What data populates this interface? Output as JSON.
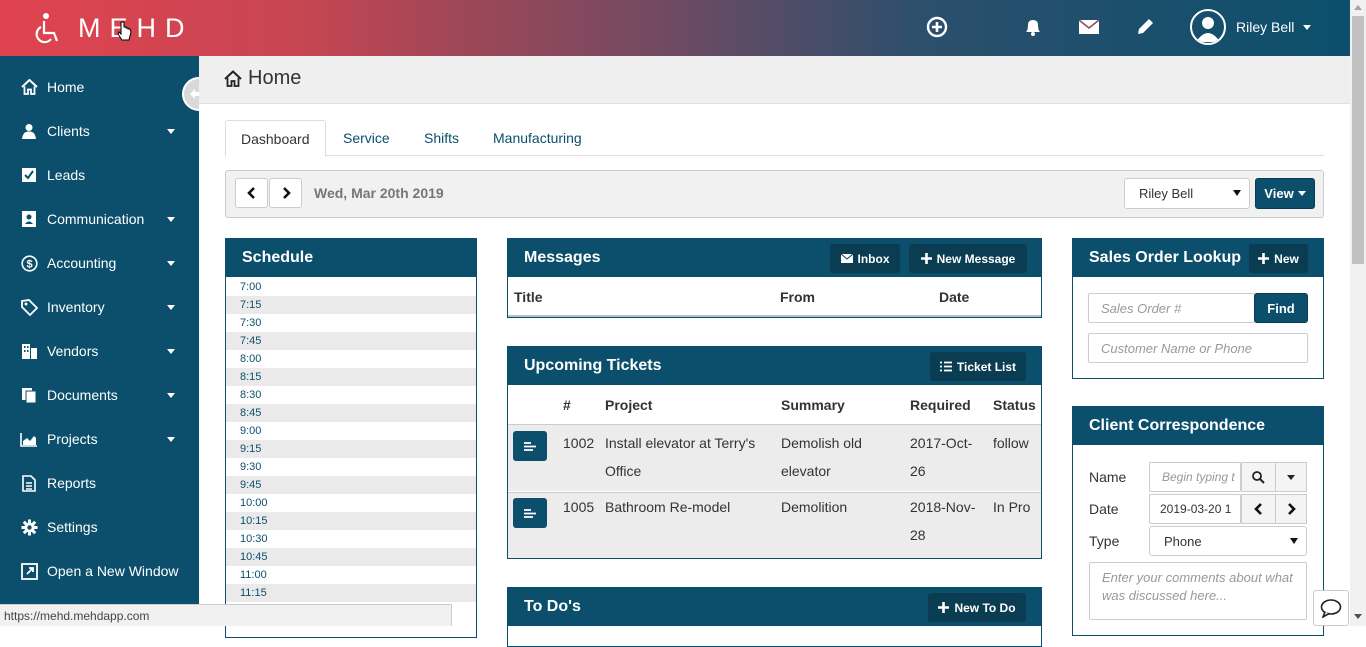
{
  "app": {
    "logo_text": "MEHD",
    "colors": {
      "primary": "#0b4f6c",
      "brand_red": "#e0434f",
      "header_bg": "#efefef"
    },
    "topbar_icons": [
      "plus-circle-icon",
      "bell-icon",
      "envelope-icon",
      "pencil-icon"
    ],
    "user": {
      "name": "Riley Bell",
      "avatar_icon": "user-circle-icon"
    }
  },
  "sidebar": {
    "items": [
      {
        "label": "Home",
        "icon": "home-icon",
        "has_caret": false
      },
      {
        "label": "Clients",
        "icon": "user-icon",
        "has_caret": true
      },
      {
        "label": "Leads",
        "icon": "check-square-icon",
        "has_caret": false
      },
      {
        "label": "Communication",
        "icon": "contact-card-icon",
        "has_caret": true
      },
      {
        "label": "Accounting",
        "icon": "dollar-circle-icon",
        "has_caret": true
      },
      {
        "label": "Inventory",
        "icon": "tag-icon",
        "has_caret": true
      },
      {
        "label": "Vendors",
        "icon": "building-icon",
        "has_caret": true
      },
      {
        "label": "Documents",
        "icon": "files-icon",
        "has_caret": true
      },
      {
        "label": "Projects",
        "icon": "area-chart-icon",
        "has_caret": true
      },
      {
        "label": "Reports",
        "icon": "report-icon",
        "has_caret": false
      },
      {
        "label": "Settings",
        "icon": "gear-icon",
        "has_caret": false
      },
      {
        "label": "Open a New Window",
        "icon": "external-window-icon",
        "has_caret": false
      }
    ]
  },
  "page": {
    "title": "Home",
    "tabs": [
      {
        "label": "Dashboard",
        "active": true
      },
      {
        "label": "Service",
        "active": false
      },
      {
        "label": "Shifts",
        "active": false
      },
      {
        "label": "Manufacturing",
        "active": false
      }
    ],
    "datebar": {
      "date": "Wed, Mar 20th 2019",
      "user_select": "Riley Bell",
      "view_label": "View"
    }
  },
  "schedule": {
    "title": "Schedule",
    "times": [
      "7:00",
      "7:15",
      "7:30",
      "7:45",
      "8:00",
      "8:15",
      "8:30",
      "8:45",
      "9:00",
      "9:15",
      "9:30",
      "9:45",
      "10:00",
      "10:15",
      "10:30",
      "10:45",
      "11:00",
      "11:15"
    ]
  },
  "messages": {
    "title": "Messages",
    "inbox_label": "Inbox",
    "new_label": "New Message",
    "columns": [
      "Title",
      "From",
      "Date"
    ]
  },
  "tickets": {
    "title": "Upcoming Tickets",
    "list_label": "Ticket List",
    "columns": [
      "#",
      "Project",
      "Summary",
      "Required",
      "Status"
    ],
    "rows": [
      {
        "num": "1002",
        "project_l1": "Install elevator at Terry's",
        "project_l2": "Office",
        "summary_l1": "Demolish old",
        "summary_l2": "elevator",
        "required_l1": "2017-Oct-",
        "required_l2": "26",
        "status": "follow"
      },
      {
        "num": "1005",
        "project_l1": "Bathroom Re-model",
        "project_l2": "",
        "summary_l1": "Demolition",
        "summary_l2": "",
        "required_l1": "2018-Nov-",
        "required_l2": "28",
        "status": "In Pro"
      }
    ]
  },
  "todos": {
    "title": "To Do's",
    "new_label": "New To Do"
  },
  "sales": {
    "title": "Sales Order Lookup",
    "new_label": "New",
    "order_placeholder": "Sales Order #",
    "find_label": "Find",
    "customer_placeholder": "Customer Name or Phone"
  },
  "correspondence": {
    "title": "Client Correspondence",
    "name_label": "Name",
    "name_placeholder": "Begin typing t",
    "date_label": "Date",
    "date_value": "2019-03-20 1",
    "type_label": "Type",
    "type_value": "Phone",
    "comments_placeholder": "Enter your comments about what was discussed here..."
  },
  "statusbar": {
    "url": "https://mehd.mehdapp.com"
  }
}
